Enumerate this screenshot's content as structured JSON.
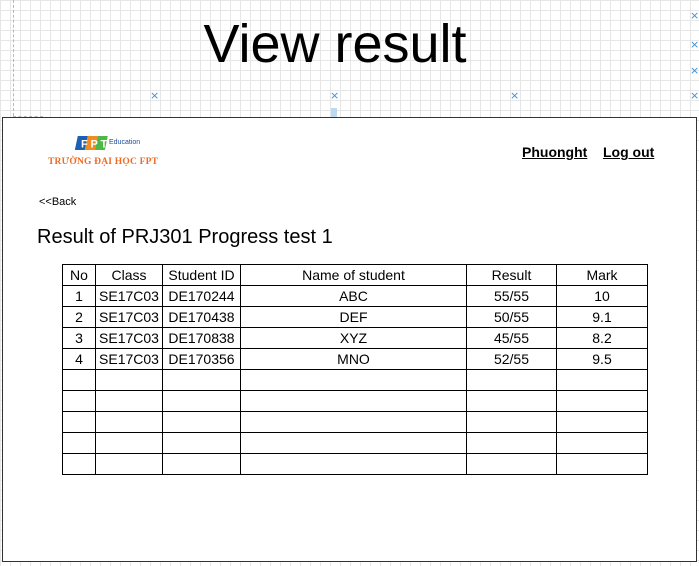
{
  "canvas": {
    "title": "View result"
  },
  "logo": {
    "brand": "FPT",
    "tagline": "Education",
    "school": "TRƯỜNG ĐẠI HỌC FPT",
    "colors": {
      "F": "#1d5fb3",
      "P": "#f28c1f",
      "T": "#4cb848"
    }
  },
  "header": {
    "username": "Phuonght",
    "logout": "Log out"
  },
  "nav": {
    "back": "<<Back"
  },
  "page": {
    "heading": "Result of PRJ301 Progress test 1"
  },
  "table": {
    "columns": [
      "No",
      "Class",
      "Student ID",
      "Name of student",
      "Result",
      "Mark"
    ],
    "rows": [
      [
        "1",
        "SE17C03",
        "DE170244",
        "ABC",
        "55/55",
        "10"
      ],
      [
        "2",
        "SE17C03",
        "DE170438",
        "DEF",
        "50/55",
        "9.1"
      ],
      [
        "3",
        "SE17C03",
        "DE170838",
        "XYZ",
        "45/55",
        "8.2"
      ],
      [
        "4",
        "SE17C03",
        "DE170356",
        "MNO",
        "52/55",
        "9.5"
      ]
    ],
    "empty_rows": 5
  },
  "decor": {
    "handle_glyph": "×",
    "handle_color": "#3b8fd6",
    "grid_color": "#e6e6e6"
  }
}
